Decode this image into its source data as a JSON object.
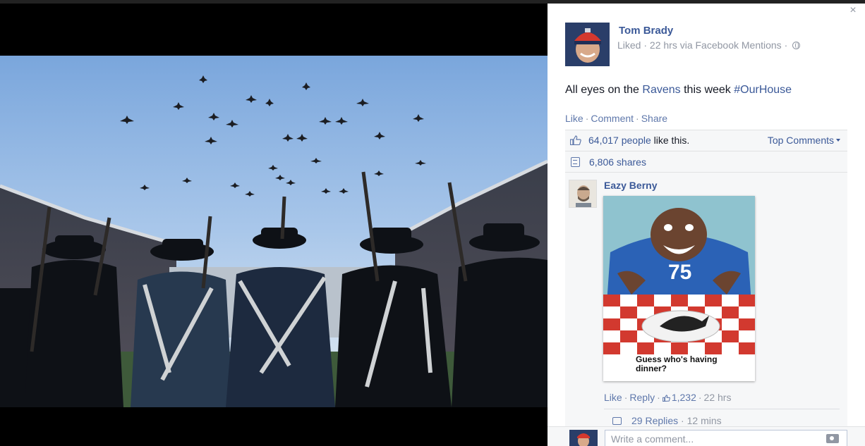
{
  "post": {
    "author": "Tom Brady",
    "meta_text": "Liked · 22 hrs via Facebook Mentions ·",
    "text_before": "All eyes on the ",
    "text_link": "Ravens",
    "text_middle": " this week ",
    "text_hashtag": "#OurHouse"
  },
  "actions": {
    "like": "Like",
    "comment": "Comment",
    "share": "Share"
  },
  "stats": {
    "likes_link": "64,017 people",
    "likes_suffix": " like this.",
    "top_comments": "Top Comments",
    "shares": "6,806 shares"
  },
  "comment": {
    "author": "Eazy Berny",
    "image_caption": "Guess who's having dinner?",
    "jersey_number": "75",
    "like": "Like",
    "reply": "Reply",
    "like_count": "1,232",
    "time": "22 hrs",
    "replies": "29 Replies",
    "replies_time": "12 mins"
  },
  "composer": {
    "placeholder": "Write a comment..."
  },
  "icons": {
    "close": "close-icon",
    "privacy": "globe-icon",
    "like": "thumbs-up-icon",
    "share": "share-icon",
    "reply": "reply-icon",
    "camera": "camera-icon"
  },
  "colors": {
    "link": "#3b5998",
    "muted": "#9197a3",
    "panel": "#f6f7f8"
  }
}
